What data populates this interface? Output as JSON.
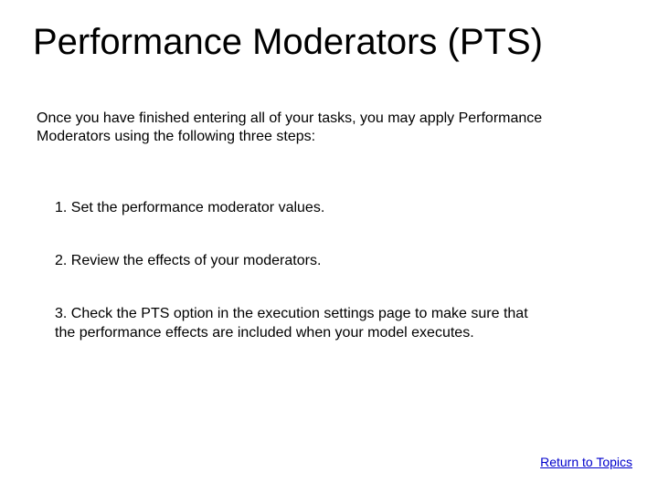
{
  "title": "Performance Moderators (PTS)",
  "intro": "Once you have finished entering all of your tasks, you may apply Performance Moderators using the following three steps:",
  "steps": {
    "s1": "1. Set the performance moderator values.",
    "s2": "2. Review the effects of your moderators.",
    "s3": "3. Check the PTS option in the execution settings page to make sure that the performance effects are included when your model executes."
  },
  "link": "Return to Topics"
}
